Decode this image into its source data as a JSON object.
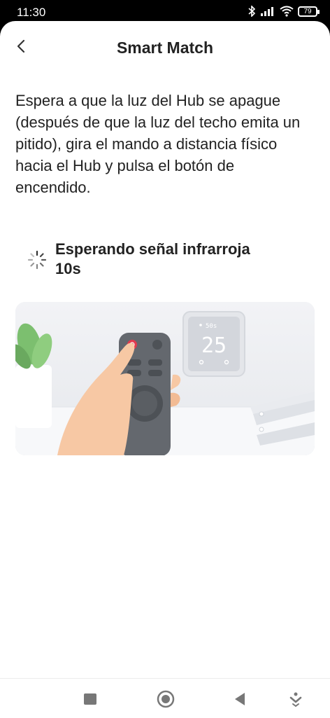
{
  "status_bar": {
    "time": "11:30",
    "battery": "79"
  },
  "header": {
    "title": "Smart Match"
  },
  "instruction": "Espera a que la luz del Hub se apague (después de que la luz del techo emita un pitido), gira el mando a distancia físico hacia el Hub y pulsa el botón de encendido.",
  "waiting": {
    "label": "Esperando señal infrarroja",
    "countdown": "10s"
  },
  "illustration": {
    "display_value": "25",
    "display_small": "50s"
  },
  "icons": {
    "back": "chevron-left-icon",
    "spinner": "loading-spinner-icon",
    "nav": [
      "square-icon",
      "circle-icon",
      "triangle-back-icon",
      "down-arrow-icon"
    ]
  },
  "colors": {
    "text": "#222222",
    "background": "#ffffff",
    "power_button": "#e23b4e"
  }
}
